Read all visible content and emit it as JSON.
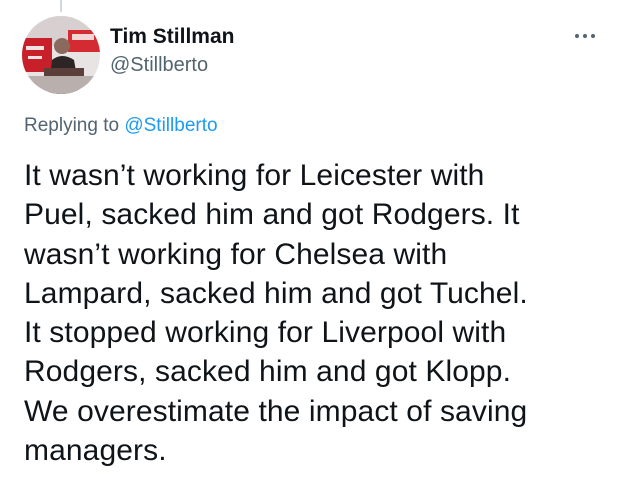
{
  "tweet": {
    "author": {
      "display_name": "Tim Stillman",
      "handle": "@Stillberto",
      "avatar_icon": "profile-photo"
    },
    "more_icon": "more-horizontal-icon",
    "replying_prefix": "Replying to",
    "replying_handle": "@Stillberto",
    "body_lines": [
      "It wasn’t working for Leicester with",
      "Puel, sacked him and got Rodgers. It",
      "wasn’t working for Chelsea with",
      "Lampard, sacked him and got Tuchel.",
      "It stopped working for Liverpool with",
      "Rodgers, sacked him and got Klopp.",
      "We overestimate the impact of saving",
      "managers."
    ]
  },
  "colors": {
    "text": "#0f1419",
    "secondary": "#536471",
    "link": "#1d9bf0"
  }
}
